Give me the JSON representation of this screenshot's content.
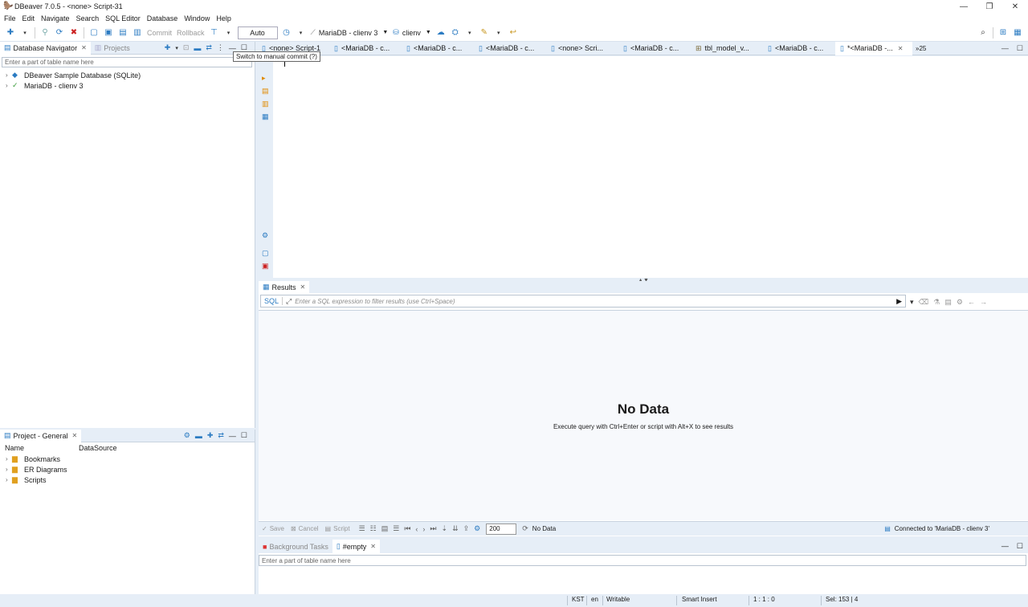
{
  "window": {
    "title": "DBeaver 7.0.5 - <none> Script-31",
    "controls": [
      "—",
      "❐",
      "✕"
    ]
  },
  "menu": [
    "File",
    "Edit",
    "Navigate",
    "Search",
    "SQL Editor",
    "Database",
    "Window",
    "Help"
  ],
  "toolbar": {
    "commit_label": "Commit",
    "rollback_label": "Rollback",
    "transaction_mode": "Auto",
    "connection": "MariaDB - clienv 3",
    "schema": "clienv",
    "tooltip": "Switch to manual commit (?)"
  },
  "navigator": {
    "tab_label": "Database Navigator",
    "projects_tab_label": "Projects",
    "filter_placeholder": "Enter a part of table name here",
    "items": [
      {
        "label": "DBeaver Sample Database (SQLite)"
      },
      {
        "label": "MariaDB - clienv 3"
      }
    ]
  },
  "project": {
    "tab_label": "Project - General",
    "col_name": "Name",
    "col_datasource": "DataSource",
    "items": [
      {
        "label": "Bookmarks"
      },
      {
        "label": "ER Diagrams"
      },
      {
        "label": "Scripts"
      }
    ]
  },
  "editor_tabs": [
    {
      "label": "<none> Script-1"
    },
    {
      "label": "<MariaDB - c..."
    },
    {
      "label": "<MariaDB - c..."
    },
    {
      "label": "<MariaDB - c..."
    },
    {
      "label": "<none> Scri..."
    },
    {
      "label": "<MariaDB - c..."
    },
    {
      "label": "tbl_model_v..."
    },
    {
      "label": "<MariaDB - c..."
    },
    {
      "label": "*<MariaDB -..."
    }
  ],
  "more_tabs": "»25",
  "results": {
    "tab_label": "Results",
    "sql_label": "SQL",
    "filter_placeholder": "Enter a SQL expression to filter results (use Ctrl+Space)",
    "nodata_title": "No Data",
    "nodata_sub": "Execute query with Ctrl+Enter or script with Alt+X to see results",
    "save_label": "Save",
    "cancel_label": "Cancel",
    "script_label": "Script",
    "fetch_size": "200",
    "status": "No Data",
    "connection_status": "Connected to 'MariaDB - clienv 3'"
  },
  "bottom_panel": {
    "bg_tasks_label": "Background Tasks",
    "empty_tab_label": "#empty",
    "filter_placeholder": "Enter a part of table name here"
  },
  "statusbar": {
    "timezone": "KST",
    "locale": "en",
    "mode": "Writable",
    "insert_mode": "Smart Insert",
    "position": "1 : 1 : 0",
    "selection": "Sel: 153 | 4"
  }
}
